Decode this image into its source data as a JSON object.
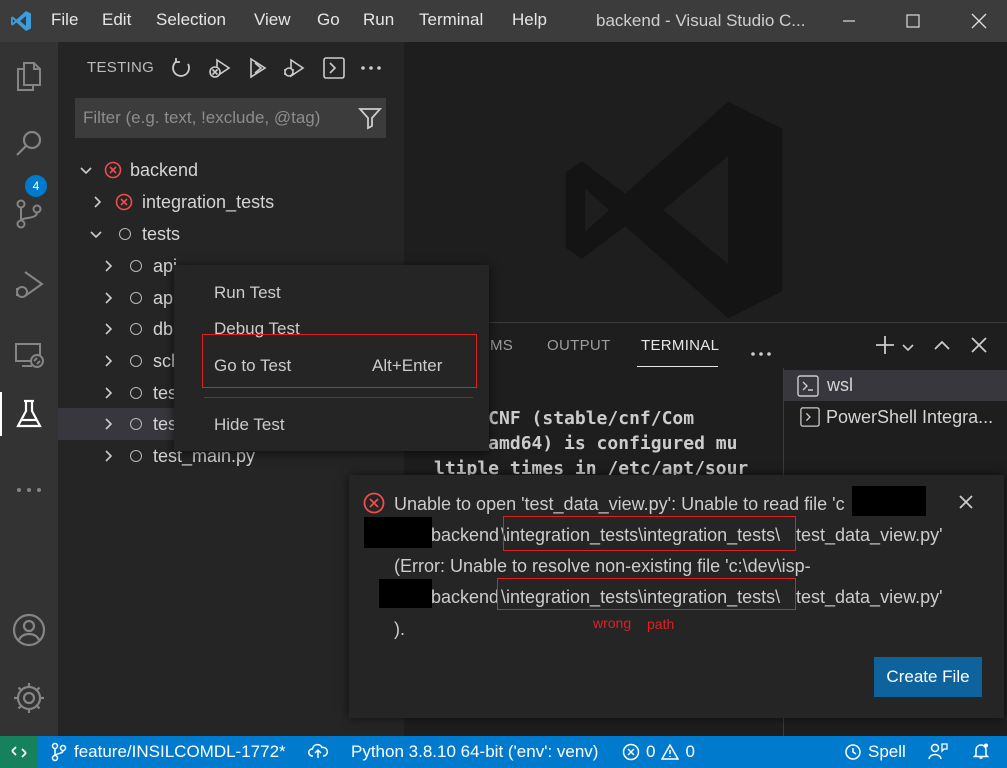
{
  "titlebar": {
    "menu": [
      "File",
      "Edit",
      "Selection",
      "View",
      "Go",
      "Run",
      "Terminal",
      "Help"
    ],
    "window_title": "backend - Visual Studio C..."
  },
  "activitybar": {
    "scm_badge": "4"
  },
  "sidebar": {
    "title": "TESTING",
    "filter_placeholder": "Filter (e.g. text, !exclude, @tag)",
    "tree": {
      "root": "backend",
      "integration_tests": "integration_tests",
      "tests": "tests",
      "children": [
        "api",
        "ap",
        "db",
        "sch",
        "tes",
        "tes",
        "test_main.py"
      ]
    }
  },
  "context_menu": {
    "run_test": "Run Test",
    "debug_test": "Debug Test",
    "go_to_test": "Go to Test",
    "go_to_test_shortcut": "Alt+Enter",
    "hide_test": "Hide Test"
  },
  "panel": {
    "tabs": {
      "problems": "MS",
      "output": "OUTPUT",
      "terminal": "TERMINAL"
    },
    "terminal_lines": [
      "rget CNF (stable/cnf/Com",
      "mand-amd64) is configured mu",
      "ltiple times in /etc/apt/sour"
    ],
    "terminals": [
      "wsl",
      "PowerShell Integra..."
    ]
  },
  "notification": {
    "line1": "Unable to open 'test_data_view.py': Unable to read file 'c",
    "line2_prefix": "backend",
    "line2_path": "\\integration_tests\\integration_tests\\",
    "line2_suffix": "test_data_view.py'",
    "line3": "(Error: Unable to resolve non-existing file 'c:\\dev\\isp-",
    "line4_prefix": "backend",
    "line4_path": "\\integration_tests\\integration_tests\\",
    "line4_suffix": "test_data_view.py'",
    "line5": ").",
    "annotation_wrong": "wrong",
    "annotation_path": "path",
    "create_file": "Create File"
  },
  "statusbar": {
    "branch": "feature/INSILCOMDL-1772*",
    "python": "Python 3.8.10 64-bit ('env': venv)",
    "errors": "0",
    "warnings": "0",
    "spell": "Spell"
  },
  "colors": {
    "accent": "#007acc",
    "error": "#f14c4c",
    "remote": "#16825d",
    "annotation": "#e02020"
  }
}
